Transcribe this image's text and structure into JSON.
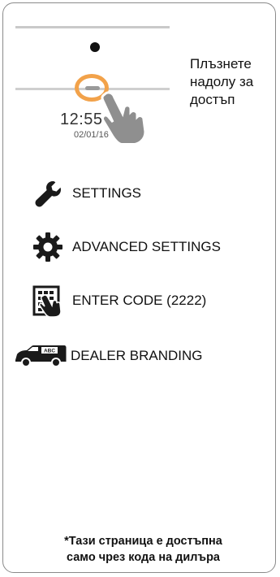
{
  "preview": {
    "time": "12:55",
    "date": "02/01/16"
  },
  "swipe_hint": "Плъзнете\nнадолу за\nдостъп",
  "menu": {
    "settings": {
      "label": "SETTINGS",
      "icon": "wrench-icon"
    },
    "advanced_settings": {
      "label": "ADVANCED SETTINGS",
      "icon": "gear-icon"
    },
    "enter_code": {
      "label": "ENTER CODE (2222)",
      "icon": "keypad-hand-icon"
    },
    "dealer_branding": {
      "label": "DEALER BRANDING",
      "icon": "van-icon",
      "badge": "ABC"
    }
  },
  "footnote": {
    "line1": "*Тази страница е достъпна",
    "line2": "само чрез кода на дилъра"
  },
  "colors": {
    "highlight_ring": "#f2a24a",
    "icon": "#1a1a1a"
  }
}
